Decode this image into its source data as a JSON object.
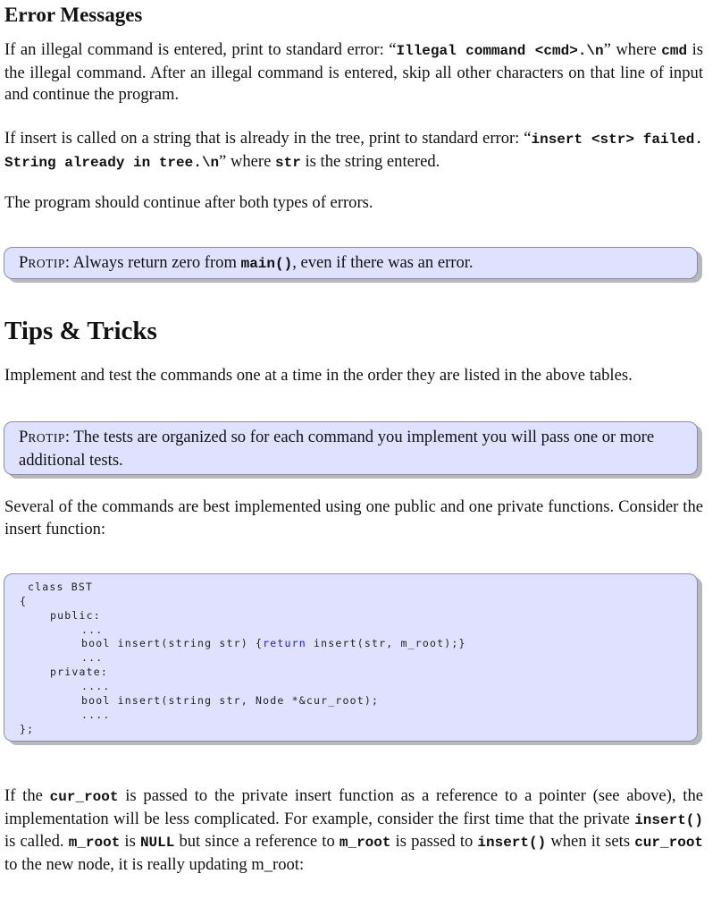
{
  "sections": {
    "errors": {
      "heading": "Error Messages",
      "p1": {
        "t1": "If an illegal command is entered, print to standard error: “",
        "code1": "Illegal command <cmd>.\\n",
        "t2": "” where ",
        "code2": "cmd",
        "t3": " is the illegal command. After an illegal command is entered, skip all other characters on that line of input and continue the program."
      },
      "p2": {
        "t1": "If insert is called on a string that is already in the tree, print to standard error: “",
        "code1": "insert <str> failed.  String already in tree.\\n",
        "t2": "” where ",
        "code2": "str",
        "t3": " is the string entered."
      },
      "p3": "The program should continue after both types of errors.",
      "protip": {
        "label_first": "P",
        "label_rest": "ROTIP",
        "colon": ": ",
        "t1": "Always return zero from ",
        "code": "main()",
        "t2": ", even if there was an error."
      }
    },
    "tips": {
      "heading": "Tips & Tricks",
      "p4": "Implement and test the commands one at a time in the order they are listed in the above tables.",
      "protip": {
        "label_first": "P",
        "label_rest": "ROTIP",
        "colon": ": ",
        "text": "The tests are organized so for each command you implement you will pass one or more additional tests."
      },
      "p5": "Several of the commands are best implemented using one public and one private functions. Consider the insert function:",
      "code": {
        "lines": [
          "class BST",
          "{",
          "public:",
          "...",
          "bool insert(string str) {",
          "return",
          " insert(str, m_root);}",
          "...",
          "private:",
          "....",
          "bool insert(string str, Node *&cur_root);",
          "....",
          "};"
        ]
      },
      "p6": {
        "t1": "If the ",
        "c1": "cur_root",
        "t2": " is passed to the private insert function as a reference to a pointer (see above), the implementation will be less complicated. For example, consider the first time that the private ",
        "c2": "insert()",
        "t3": " is called. ",
        "c3": "m_root",
        "t4": " is ",
        "c4": "NULL",
        "t5": " but since a reference to ",
        "c5": "m_root",
        "t6": " is passed to ",
        "c6": "insert()",
        "t7": " when it sets ",
        "c7": "cur_root",
        "t8": " to the new node, it is really updating m_root:"
      }
    }
  },
  "colors": {
    "box_background": "#e0e0ff",
    "box_border": "#8c8ca8",
    "box_shadow": "#b8b8b8",
    "keyword": "#1a1ad0"
  }
}
